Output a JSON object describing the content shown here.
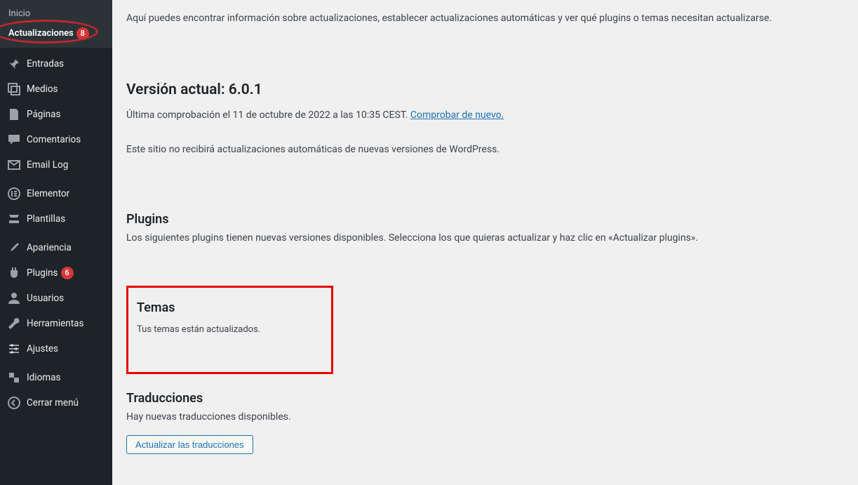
{
  "sidebar": {
    "submenu": {
      "inicio": "Inicio",
      "actualizaciones": "Actualizaciones",
      "actualizaciones_badge": "8"
    },
    "items": [
      {
        "label": "Entradas"
      },
      {
        "label": "Medios"
      },
      {
        "label": "Páginas"
      },
      {
        "label": "Comentarios"
      },
      {
        "label": "Email Log"
      },
      {
        "label": "Elementor"
      },
      {
        "label": "Plantillas"
      },
      {
        "label": "Apariencia"
      },
      {
        "label": "Plugins",
        "badge": "6"
      },
      {
        "label": "Usuarios"
      },
      {
        "label": "Herramientas"
      },
      {
        "label": "Ajustes"
      },
      {
        "label": "Idiomas"
      },
      {
        "label": "Cerrar menú"
      }
    ]
  },
  "intro_text": "Aquí puedes encontrar información sobre actualizaciones, establecer actualizaciones automáticas y ver qué plugins o temas necesitan actualizarse.",
  "version": {
    "heading": "Versión actual: 6.0.1",
    "last_check": "Última comprobación el 11 de octubre de 2022 a las 10:35 CEST. ",
    "check_again": "Comprobar de nuevo.",
    "auto_update_msg": "Este sitio no recibirá actualizaciones automáticas de nuevas versiones de WordPress."
  },
  "plugins": {
    "heading": "Plugins",
    "text": "Los siguientes plugins tienen nuevas versiones disponibles. Selecciona los que quieras actualizar y haz clic en «Actualizar plugins»."
  },
  "themes": {
    "heading": "Temas",
    "text": "Tus temas están actualizados."
  },
  "translations": {
    "heading": "Traducciones",
    "text": "Hay nuevas traducciones disponibles.",
    "button": "Actualizar las traducciones"
  }
}
